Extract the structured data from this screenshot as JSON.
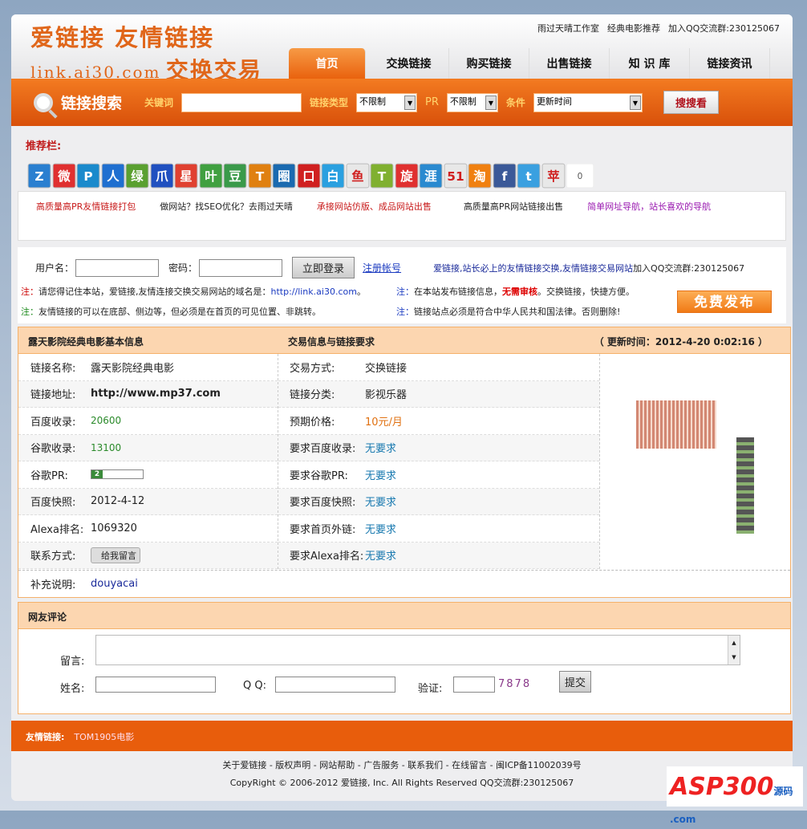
{
  "header": {
    "logo_line1": "爱链接 友情链接",
    "logo_domain": "link.ai30.com",
    "logo_line2": "交换交易",
    "top_links": [
      "雨过天晴工作室",
      "经典电影推荐",
      "加入QQ交流群:230125067"
    ],
    "nav": [
      "首页",
      "交换链接",
      "购买链接",
      "出售链接",
      "知 识 库",
      "链接资讯"
    ]
  },
  "search": {
    "title": "链接搜索",
    "keyword_label": "关键词",
    "keyword_value": "",
    "type_label": "链接类型",
    "type_value": "不限制",
    "pr_label": "PR",
    "pr_value": "不限制",
    "cond_label": "条件",
    "cond_value": "更新时间",
    "button": "搜搜看"
  },
  "recommend": {
    "title": "推荐栏:",
    "icons": [
      "Z",
      "微",
      "P",
      "人",
      "绿",
      "爪",
      "星",
      "叶",
      "豆",
      "T",
      "圈",
      "口",
      "白",
      "鱼",
      "T",
      "旋",
      "涯",
      "51",
      "淘",
      "f",
      "t",
      "苹"
    ],
    "count": "0",
    "links": [
      {
        "text": "高质量高PR友情链接打包",
        "color": "#c81a1a"
      },
      {
        "text": "做网站？找SEO优化？去雨过天晴",
        "color": "#222"
      },
      {
        "text": "承接网站仿版、成品网站出售",
        "color": "#c81a1a"
      },
      {
        "text": "高质量高PR网站链接出售",
        "color": "#222"
      },
      {
        "text": "简单网址导航，站长喜欢的导航",
        "color": "#9a1ab0"
      }
    ]
  },
  "login": {
    "user_label": "用户名：",
    "pass_label": "密码：",
    "login_btn": "立即登录",
    "register": "注册帐号",
    "slogan": "爱链接,站长必上的友情链接交换,友情链接交易网站",
    "qq_group": "加入QQ交流群:230125067",
    "note_prefix": "注：",
    "note1": "请您得记住本站，爱链接,友情连接交换交易网站的域名是：",
    "note1_url": "http://link.ai30.com",
    "note1_end": "。",
    "note2": "友情链接的可以在底部、侧边等，但必须是在首页的可见位置、非跳转。",
    "note3a": "在本站发布链接信息，",
    "note3b": "无需审核",
    "note3c": "。交换链接，快捷方便。",
    "note4": "链接站点必须是符合中华人民共和国法律。否则删除!",
    "publish": "免费发布"
  },
  "info": {
    "head_left": "露天影院经典电影基本信息",
    "head_mid": "交易信息与链接要求",
    "head_right": "（ 更新时间：2012-4-20 0:02:16 ）",
    "left": [
      {
        "k": "链接名称:",
        "v": "露天影院经典电影"
      },
      {
        "k": "链接地址:",
        "v": "http://www.mp37.com"
      },
      {
        "k": "百度收录:",
        "v": "20600"
      },
      {
        "k": "谷歌收录:",
        "v": "13100"
      },
      {
        "k": "谷歌PR:",
        "v": "2"
      },
      {
        "k": "百度快照:",
        "v": "2012-4-12"
      },
      {
        "k": "Alexa排名:",
        "v": "1069320"
      },
      {
        "k": "联系方式:",
        "v": "给我留言"
      }
    ],
    "right": [
      {
        "k": "交易方式:",
        "v": "交换链接"
      },
      {
        "k": "链接分类:",
        "v": "影视乐器"
      },
      {
        "k": "预期价格:",
        "v": "10元/月"
      },
      {
        "k": "要求百度收录:",
        "v": "无要求"
      },
      {
        "k": "要求谷歌PR:",
        "v": "无要求"
      },
      {
        "k": "要求百度快照:",
        "v": "无要求"
      },
      {
        "k": "要求首页外链:",
        "v": "无要求"
      },
      {
        "k": "要求Alexa排名:",
        "v": "无要求"
      }
    ],
    "note_label": "补充说明:",
    "note_value": "douyacai"
  },
  "comment": {
    "title": "网友评论",
    "msg_label": "留言:",
    "name_label": "姓名:",
    "qq_label": "Q Q:",
    "verify_label": "验证:",
    "captcha": "7878",
    "submit": "提交"
  },
  "friend": {
    "label": "友情链接:",
    "links": [
      "TOM1905电影"
    ]
  },
  "footer": {
    "links": "关于爱链接 - 版权声明 - 网站帮助 - 广告服务 - 联系我们 - 在线留言 - 闽ICP备11002039号",
    "copyright": "CopyRight © 2006-2012 爱链接, Inc. All Rights Reserved QQ交流群:230125067"
  },
  "watermark": {
    "text": "ASP300",
    "sub": "源码 .com"
  }
}
